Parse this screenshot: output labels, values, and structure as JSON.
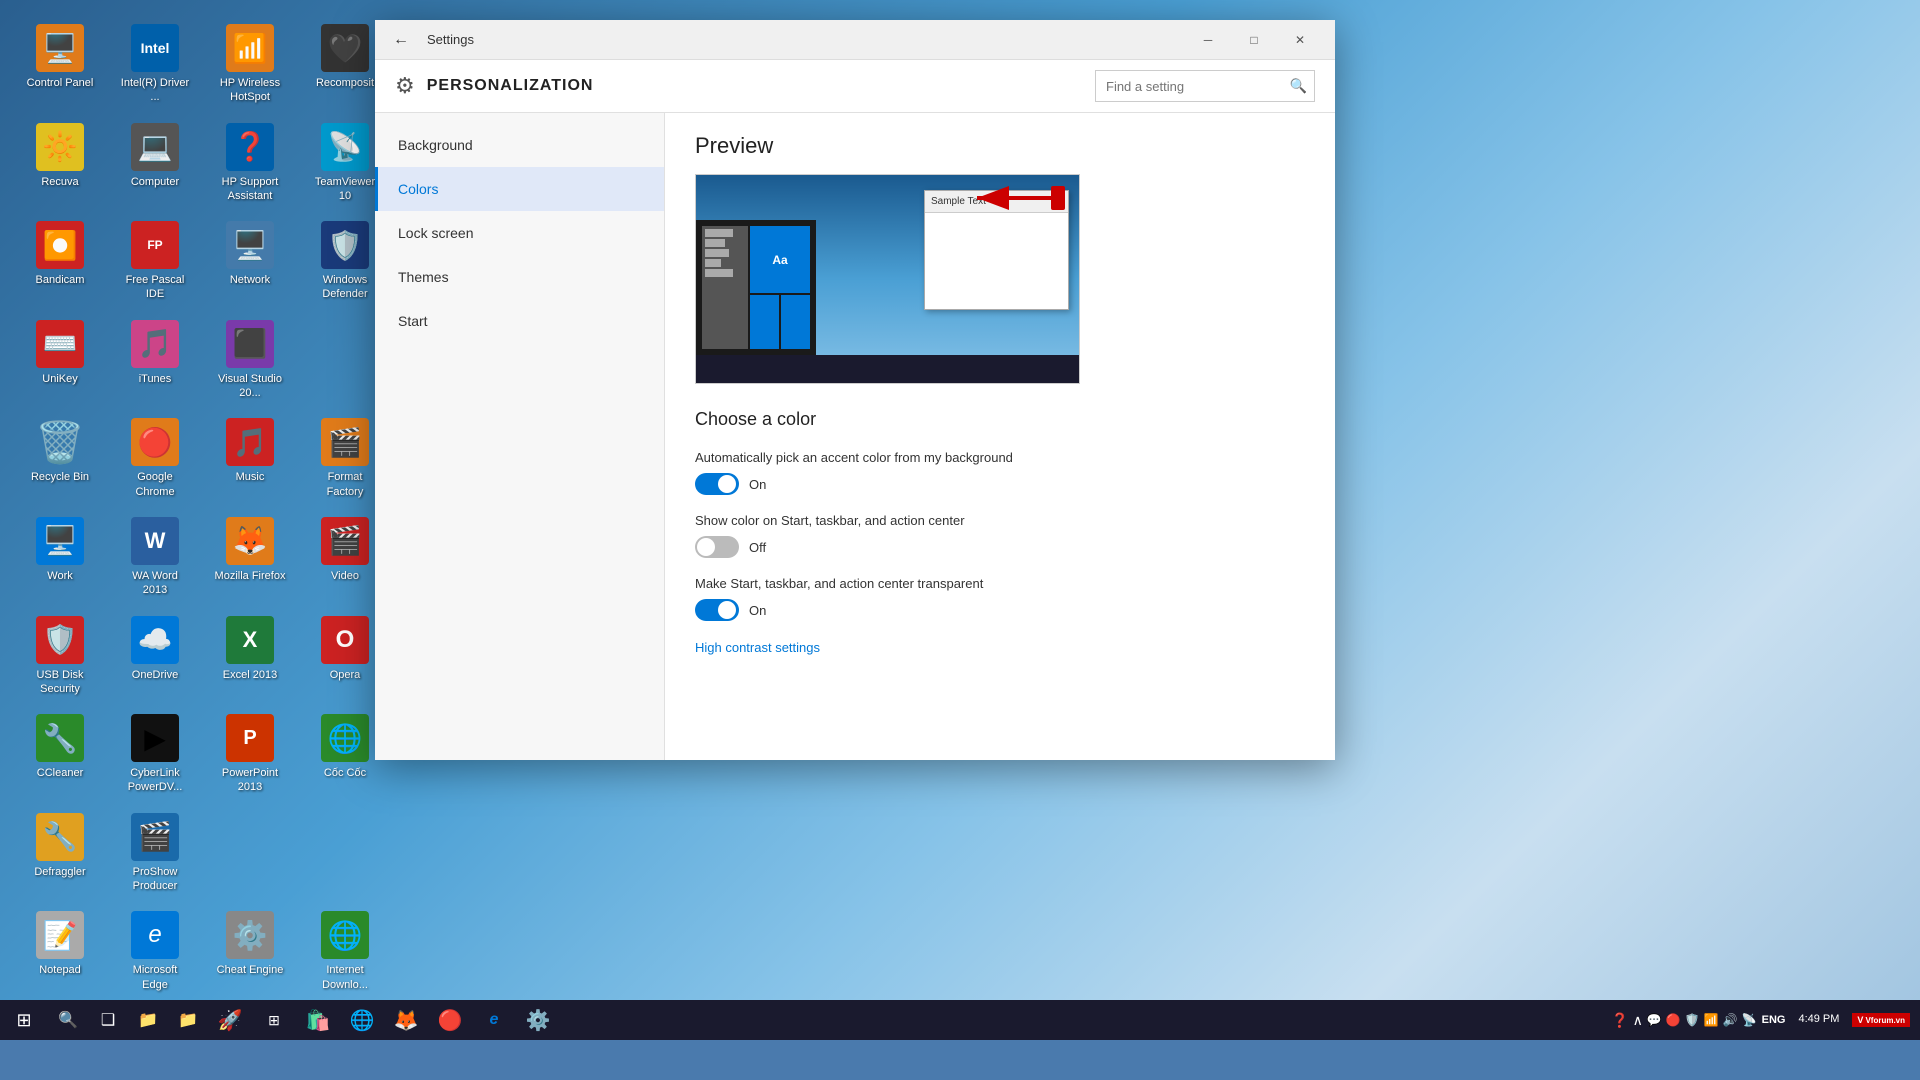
{
  "desktop": {
    "background": "blue mountain landscape"
  },
  "icons": [
    {
      "id": "control-panel",
      "label": "Control Panel",
      "emoji": "🖥️",
      "color": "#1e7ad6"
    },
    {
      "id": "intel-driver",
      "label": "Intel(R) Driver ...",
      "emoji": "🔵",
      "color": "#0060aa"
    },
    {
      "id": "hp-wireless",
      "label": "HP Wireless HotSpot",
      "emoji": "📶",
      "color": "#e07b1a"
    },
    {
      "id": "recomposit",
      "label": "Recomposit",
      "emoji": "🖤",
      "color": "#222"
    },
    {
      "id": "recuva",
      "label": "Recuva",
      "emoji": "🔆",
      "color": "#e0c020"
    },
    {
      "id": "computer",
      "label": "Computer",
      "emoji": "💻",
      "color": "#888"
    },
    {
      "id": "hp-support",
      "label": "HP Support Assistant",
      "emoji": "❓",
      "color": "#0060aa"
    },
    {
      "id": "teamviewer",
      "label": "TeamViewer 10",
      "emoji": "📡",
      "color": "#0099cc"
    },
    {
      "id": "bandicam",
      "label": "Bandicam",
      "emoji": "⏺️",
      "color": "#cc2222"
    },
    {
      "id": "free-pascal",
      "label": "Free Pascal IDE",
      "emoji": "🔷",
      "color": "#cc2222"
    },
    {
      "id": "network",
      "label": "Network",
      "emoji": "🖥️",
      "color": "#888"
    },
    {
      "id": "windows-defender",
      "label": "Windows Defender",
      "emoji": "🛡️",
      "color": "#cc2222"
    },
    {
      "id": "unikey",
      "label": "UniKey",
      "emoji": "⌨️",
      "color": "#cc2222"
    },
    {
      "id": "itunes",
      "label": "iTunes",
      "emoji": "🎵",
      "color": "#e07b1a"
    },
    {
      "id": "visual-studio",
      "label": "Visual Studio 20...",
      "emoji": "🔷",
      "color": "#7a3aaa"
    },
    {
      "id": "recycle-bin",
      "label": "Recycle Bin",
      "emoji": "🗑️",
      "color": "#888"
    },
    {
      "id": "google-chrome",
      "label": "Google Chrome",
      "emoji": "🔴",
      "color": "#e07b1a"
    },
    {
      "id": "music",
      "label": "Music",
      "emoji": "🎵",
      "color": "#e05050"
    },
    {
      "id": "format-factory",
      "label": "Format Factory",
      "emoji": "🎬",
      "color": "#e07b1a"
    },
    {
      "id": "work",
      "label": "Work",
      "emoji": "🖥️",
      "color": "#0078d7"
    },
    {
      "id": "word-2013",
      "label": "WA Word 2013",
      "emoji": "W",
      "color": "#2a5f9f"
    },
    {
      "id": "mozilla-firefox",
      "label": "Mozilla Firefox",
      "emoji": "🦊",
      "color": "#e07b1a"
    },
    {
      "id": "video",
      "label": "Video",
      "emoji": "🎬",
      "color": "#cc2222"
    },
    {
      "id": "usb-disk",
      "label": "USB Disk Security",
      "emoji": "🛡️",
      "color": "#cc2222"
    },
    {
      "id": "onedrive",
      "label": "OneDrive",
      "emoji": "☁️",
      "color": "#0078d7"
    },
    {
      "id": "excel-2013",
      "label": "Excel 2013",
      "emoji": "X",
      "color": "#1f7a3a"
    },
    {
      "id": "opera",
      "label": "Opera",
      "emoji": "O",
      "color": "#cc2222"
    },
    {
      "id": "ccleaner",
      "label": "CCleaner",
      "emoji": "🔧",
      "color": "#2a8a2a"
    },
    {
      "id": "cyberlink",
      "label": "CyberLink PowerDV...",
      "emoji": "▶",
      "color": "#222"
    },
    {
      "id": "powerpoint",
      "label": "PowerPoint 2013",
      "emoji": "P",
      "color": "#cc3300"
    },
    {
      "id": "coc-coc",
      "label": "Cốc Cốc",
      "emoji": "🌐",
      "color": "#2a8a2a"
    },
    {
      "id": "defraggler",
      "label": "Defraggler",
      "emoji": "🔧",
      "color": "#e0a020"
    },
    {
      "id": "proshow",
      "label": "ProShow Producer",
      "emoji": "🎬",
      "color": "#1a6aaa"
    },
    {
      "id": "notepad",
      "label": "Notepad",
      "emoji": "📝",
      "color": "#888"
    },
    {
      "id": "microsoft-edge",
      "label": "Microsoft Edge",
      "emoji": "e",
      "color": "#0078d7"
    },
    {
      "id": "cheat-engine",
      "label": "Cheat Engine",
      "emoji": "⚙️",
      "color": "#888"
    },
    {
      "id": "internet-download",
      "label": "Internet Downlo...",
      "emoji": "🌐",
      "color": "#2a8a2a"
    }
  ],
  "settings": {
    "window_title": "Settings",
    "section_title": "PERSONALIZATION",
    "search_placeholder": "Find a setting",
    "nav_items": [
      {
        "id": "background",
        "label": "Background"
      },
      {
        "id": "colors",
        "label": "Colors",
        "active": true
      },
      {
        "id": "lock-screen",
        "label": "Lock screen"
      },
      {
        "id": "themes",
        "label": "Themes"
      },
      {
        "id": "start",
        "label": "Start"
      }
    ],
    "preview": {
      "title": "Preview",
      "sample_text": "Sample Text"
    },
    "colors": {
      "section_title": "Choose a color",
      "auto_pick_label": "Automatically pick an accent color from my background",
      "auto_pick_state": "On",
      "auto_pick_on": true,
      "show_color_label": "Show color on Start, taskbar, and action center",
      "show_color_state": "Off",
      "show_color_on": false,
      "transparent_label": "Make Start, taskbar, and action center transparent",
      "transparent_state": "On",
      "transparent_on": true,
      "high_contrast_link": "High contrast settings"
    }
  },
  "taskbar": {
    "time": "4:49 PM",
    "date": "",
    "language": "ENG",
    "apps": [
      "⊞",
      "🔍",
      "❑",
      "📁",
      "📁",
      "🚀",
      "⊞",
      "🛍️",
      "🌐",
      "🦊",
      "🔴",
      "e",
      "⚙️"
    ],
    "sys_icons": [
      "❓",
      "^",
      "💬",
      "🔴",
      "⊞",
      "🔊",
      "📶"
    ]
  }
}
